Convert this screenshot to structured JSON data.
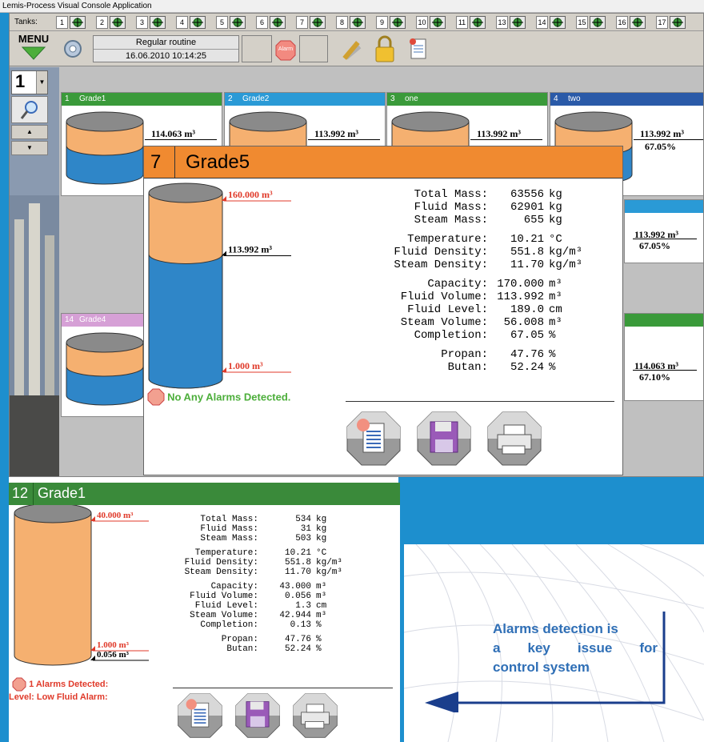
{
  "app": {
    "title": "Lemis-Process Visual Console Application"
  },
  "toolbar": {
    "tanks_label": "Tanks:",
    "tanks": [
      "1",
      "2",
      "3",
      "4",
      "5",
      "6",
      "7",
      "8",
      "9",
      "10",
      "11",
      "13",
      "14",
      "15",
      "16",
      "17"
    ],
    "menu_label": "MENU",
    "status_mode": "Regular routine",
    "status_datetime": "16.06.2010 10:14:25",
    "alarm_icon_text": "Alarm",
    "selector_value": "1"
  },
  "minis": [
    {
      "num": "1",
      "name": "Grade1",
      "color": "#3a9a3a",
      "vol": "114.063 m³"
    },
    {
      "num": "2",
      "name": "Grade2",
      "color": "#2a9ad6",
      "vol": "113.992 m³"
    },
    {
      "num": "3",
      "name": "one",
      "color": "#3a9a3a",
      "vol": "113.992 m³"
    },
    {
      "num": "4",
      "name": "two",
      "color": "#2a5aa8",
      "vol": "113.992 m³",
      "pct": "67.05%"
    },
    {
      "num": "14",
      "name": "Grade4",
      "color": "#d6a0d6"
    }
  ],
  "right_side": {
    "r2_vol": "113.992 m³",
    "r2_pct": "67.05%",
    "r3_vol": "114.063 m³",
    "r3_pct": "67.10%"
  },
  "popup_main": {
    "num": "7",
    "name": "Grade5",
    "header_color": "#f08a30",
    "tank": {
      "cap_label": "160.000 m³",
      "level_label": "113.992 m³",
      "min_label": "1.000 m³",
      "fill_pct": 67.05
    },
    "alarm_text": "No Any Alarms Detected.",
    "rows": [
      [
        "Total Mass:",
        "63556",
        "kg"
      ],
      [
        "Fluid Mass:",
        "62901",
        "kg"
      ],
      [
        "Steam Mass:",
        "655",
        "kg"
      ],
      [
        "Temperature:",
        "10.21",
        "°C"
      ],
      [
        "Fluid Density:",
        "551.8",
        "kg/m³"
      ],
      [
        "Steam Density:",
        "11.70",
        "kg/m³"
      ],
      [
        "Capacity:",
        "170.000",
        "m³"
      ],
      [
        "Fluid Volume:",
        "113.992",
        "m³"
      ],
      [
        "Fluid Level:",
        "189.0",
        "cm"
      ],
      [
        "Steam Volume:",
        "56.008",
        "m³"
      ],
      [
        "Completion:",
        "67.05",
        "%"
      ],
      [
        "Propan:",
        "47.76",
        "%"
      ],
      [
        "Butan:",
        "52.24",
        "%"
      ]
    ]
  },
  "popup_small": {
    "num": "12",
    "name": "Grade1",
    "header_color": "#3a8a3a",
    "tank": {
      "cap_label": "40.000 m³",
      "min_label": "1.000 m³",
      "level_label": "0.056 m³",
      "fill_pct": 0.13
    },
    "alarm_line1": "1 Alarms Detected:",
    "alarm_line2": "Level: Low Fluid Alarm:",
    "rows": [
      [
        "Total Mass:",
        "534",
        "kg"
      ],
      [
        "Fluid Mass:",
        "31",
        "kg"
      ],
      [
        "Steam Mass:",
        "503",
        "kg"
      ],
      [
        "Temperature:",
        "10.21",
        "°C"
      ],
      [
        "Fluid Density:",
        "551.8",
        "kg/m³"
      ],
      [
        "Steam Density:",
        "11.70",
        "kg/m³"
      ],
      [
        "Capacity:",
        "43.000",
        "m³"
      ],
      [
        "Fluid Volume:",
        "0.056",
        "m³"
      ],
      [
        "Fluid Level:",
        "1.3",
        "cm"
      ],
      [
        "Steam Volume:",
        "42.944",
        "m³"
      ],
      [
        "Completion:",
        "0.13",
        "%"
      ],
      [
        "Propan:",
        "47.76",
        "%"
      ],
      [
        "Butan:",
        "52.24",
        "%"
      ]
    ]
  },
  "annotation": {
    "line1": "Alarms detection is",
    "line2": "a key issue for",
    "line3": "control system"
  },
  "colors": {
    "accent_blue": "#2a9ad6",
    "tank_orange": "#f5b070",
    "tank_blue": "#2f86c8",
    "alarm_red": "#e03a2a",
    "ok_green": "#4cae3a",
    "frame_blue": "#1d8fce"
  }
}
